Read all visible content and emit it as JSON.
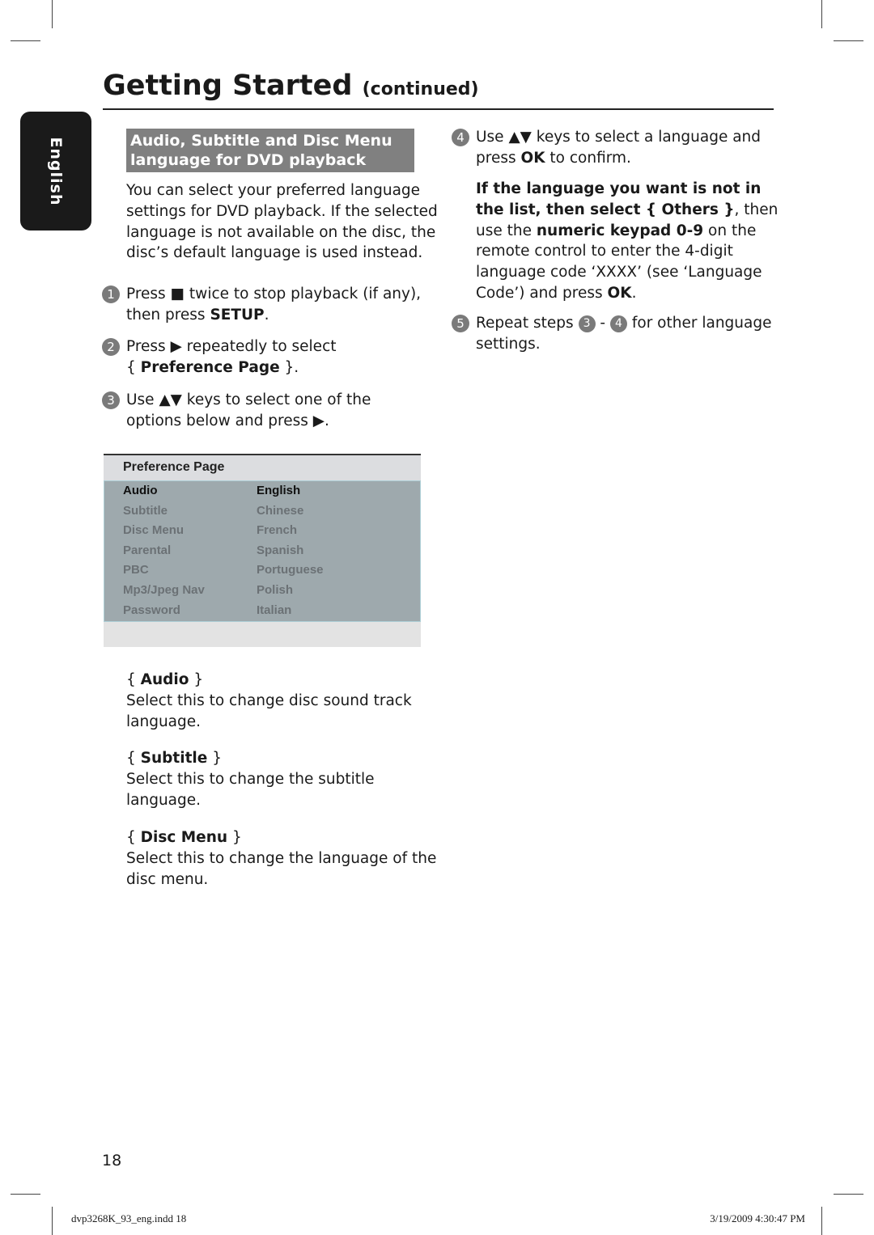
{
  "header": {
    "title": "Getting Started",
    "subtitle": "(continued)"
  },
  "side_tab": {
    "label": "English"
  },
  "section": {
    "heading_lines": [
      "Audio, Subtitle and Disc Menu",
      "language for DVD playback"
    ]
  },
  "intro": [
    [
      {
        "t": "You can select your preferred language"
      }
    ],
    [
      {
        "t": "settings for DVD playback. If the selected"
      }
    ],
    [
      {
        "t": "language is not available on the disc, the"
      }
    ],
    [
      {
        "t": "disc’s default language is used instead."
      }
    ]
  ],
  "steps": [
    {
      "num": "1",
      "lines": [
        [
          {
            "t": "Press ■ twice to stop playback (if any),"
          }
        ],
        [
          {
            "t": "then press "
          },
          {
            "t": "SETUP",
            "b": true
          },
          {
            "t": "."
          }
        ]
      ]
    },
    {
      "num": "2",
      "lines": [
        [
          {
            "t": "Press ▶ repeatedly to select"
          }
        ],
        [
          {
            "t": "{ "
          },
          {
            "t": "Preference Page",
            "b": true
          },
          {
            "t": " }."
          }
        ]
      ]
    },
    {
      "num": "3",
      "lines": [
        [
          {
            "t": "Use ▲▼ keys to select one of the"
          }
        ],
        [
          {
            "t": "options below and press ▶."
          }
        ]
      ]
    },
    {
      "num": "4",
      "lines": [
        [
          {
            "t": "Use ▲▼ keys to select a language and"
          }
        ],
        [
          {
            "t": "press "
          },
          {
            "t": "OK",
            "b": true
          },
          {
            "t": " to confirm."
          }
        ]
      ]
    }
  ],
  "note": [
    [
      {
        "t": "If the language you want is not in",
        "b": true
      }
    ],
    [
      {
        "t": "the list, then select { Others }",
        "b": true
      },
      {
        "t": ", then"
      }
    ],
    [
      {
        "t": "use the "
      },
      {
        "t": "numeric keypad 0-9",
        "b": true
      },
      {
        "t": " on the"
      }
    ],
    [
      {
        "t": "remote control to enter the 4-digit"
      }
    ],
    [
      {
        "t": "language code ‘XXXX’ (see ‘Language"
      }
    ],
    [
      {
        "t": "Code’) and press "
      },
      {
        "t": "OK",
        "b": true
      },
      {
        "t": "."
      }
    ]
  ],
  "step5": {
    "num": "5",
    "line1_a": "Repeat steps ",
    "ref1": "3",
    "sep": " - ",
    "ref2": "4",
    "line1_b": " for other language",
    "line2": "settings."
  },
  "menu": {
    "title": "Preference Page",
    "rows": [
      {
        "item": "Audio",
        "value": "English",
        "active": true
      },
      {
        "item": "Subtitle",
        "value": "Chinese"
      },
      {
        "item": "Disc Menu",
        "value": "French"
      },
      {
        "item": "Parental",
        "value": "Spanish"
      },
      {
        "item": "PBC",
        "value": "Portuguese"
      },
      {
        "item": "Mp3/Jpeg Nav",
        "value": "Polish"
      },
      {
        "item": "Password",
        "value": "Italian"
      }
    ]
  },
  "options": [
    {
      "lines": [
        [
          {
            "t": "{ "
          },
          {
            "t": "Audio",
            "b": true
          },
          {
            "t": " }"
          }
        ],
        [
          {
            "t": "Select this to change disc sound track"
          }
        ],
        [
          {
            "t": "language."
          }
        ]
      ]
    },
    {
      "lines": [
        [
          {
            "t": "{ "
          },
          {
            "t": "Subtitle",
            "b": true
          },
          {
            "t": " }"
          }
        ],
        [
          {
            "t": "Select this to change the subtitle"
          }
        ],
        [
          {
            "t": "language."
          }
        ]
      ]
    },
    {
      "lines": [
        [
          {
            "t": "{ "
          },
          {
            "t": "Disc Menu",
            "b": true
          },
          {
            "t": " }"
          }
        ],
        [
          {
            "t": "Select this to change the language of the"
          }
        ],
        [
          {
            "t": "disc menu."
          }
        ]
      ]
    }
  ],
  "page_number": "18",
  "footer": {
    "file": "dvp3268K_93_eng.indd   18",
    "timestamp": "3/19/2009   4:30:47 PM"
  },
  "colors": {
    "heading_bg": "#808080",
    "tab_bg": "#1a1a1a",
    "menu_body": "#9ea9ad",
    "menu_header": "#dcdde0",
    "step_circle": "#7a7a7a"
  }
}
